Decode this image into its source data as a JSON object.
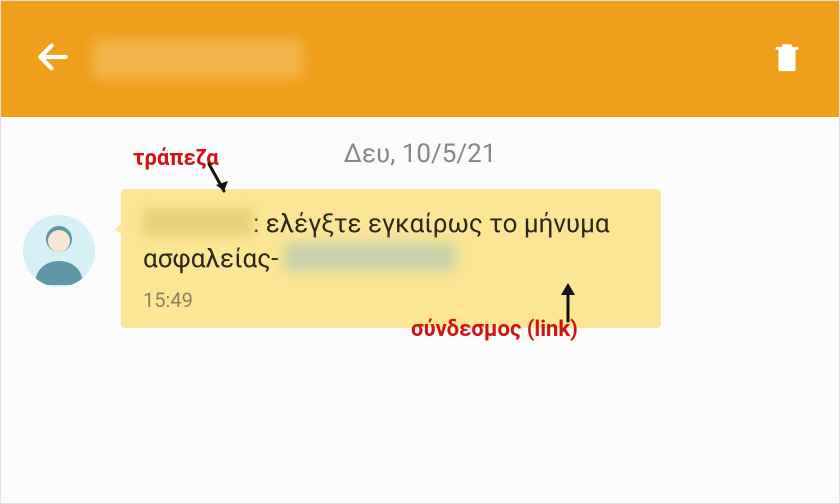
{
  "header": {
    "back_icon": "back-arrow",
    "delete_icon": "trash",
    "sender_redacted": true
  },
  "conversation": {
    "date_label": "Δευ, 10/5/21",
    "message": {
      "sender_redacted": true,
      "body_before_link": ": ελέγξτε εγκαίρως το μήνυμα ασφαλείας- ",
      "link_redacted": true,
      "time": "15:49"
    }
  },
  "annotations": {
    "bank_label": "τράπεζα",
    "link_label": "σύνδεσμος (link)"
  }
}
